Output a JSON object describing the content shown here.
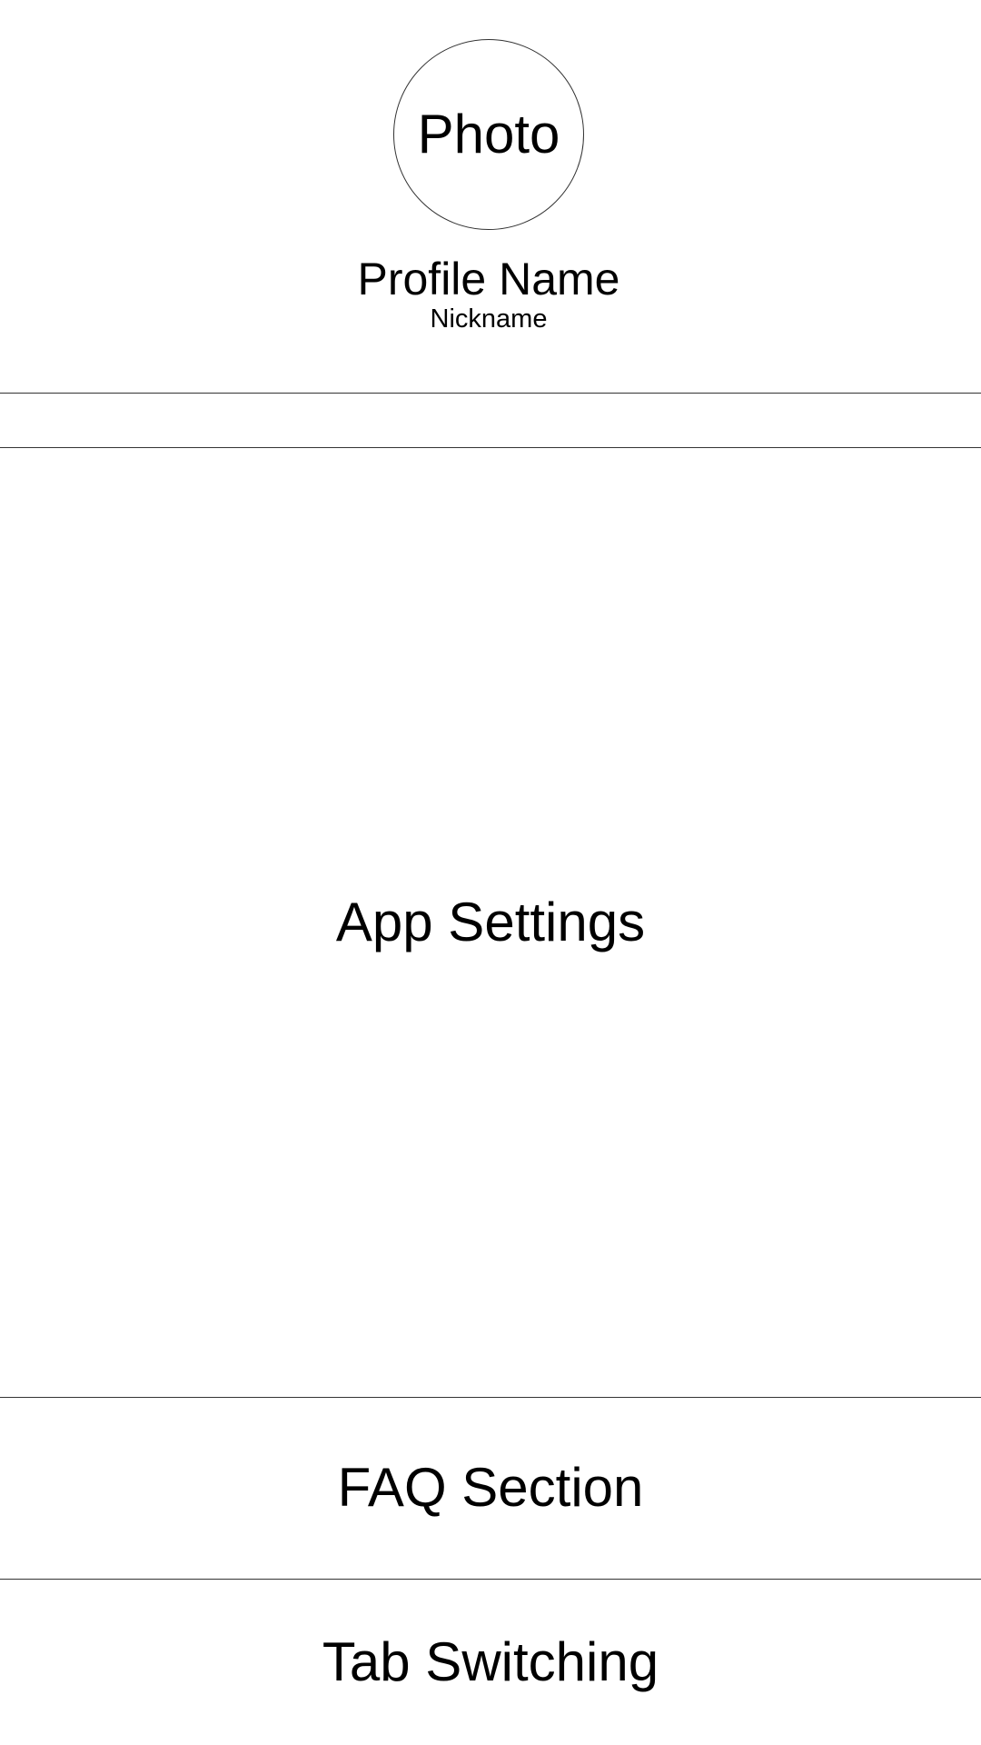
{
  "profile": {
    "photo_label": "Photo",
    "name": "Profile Name",
    "nickname": "Nickname"
  },
  "sections": {
    "app_settings": "App Settings",
    "faq": "FAQ Section",
    "tab_switching": "Tab Switching"
  },
  "colors": {
    "background": "#ffffff",
    "line": "#333333",
    "text": "#000000"
  }
}
